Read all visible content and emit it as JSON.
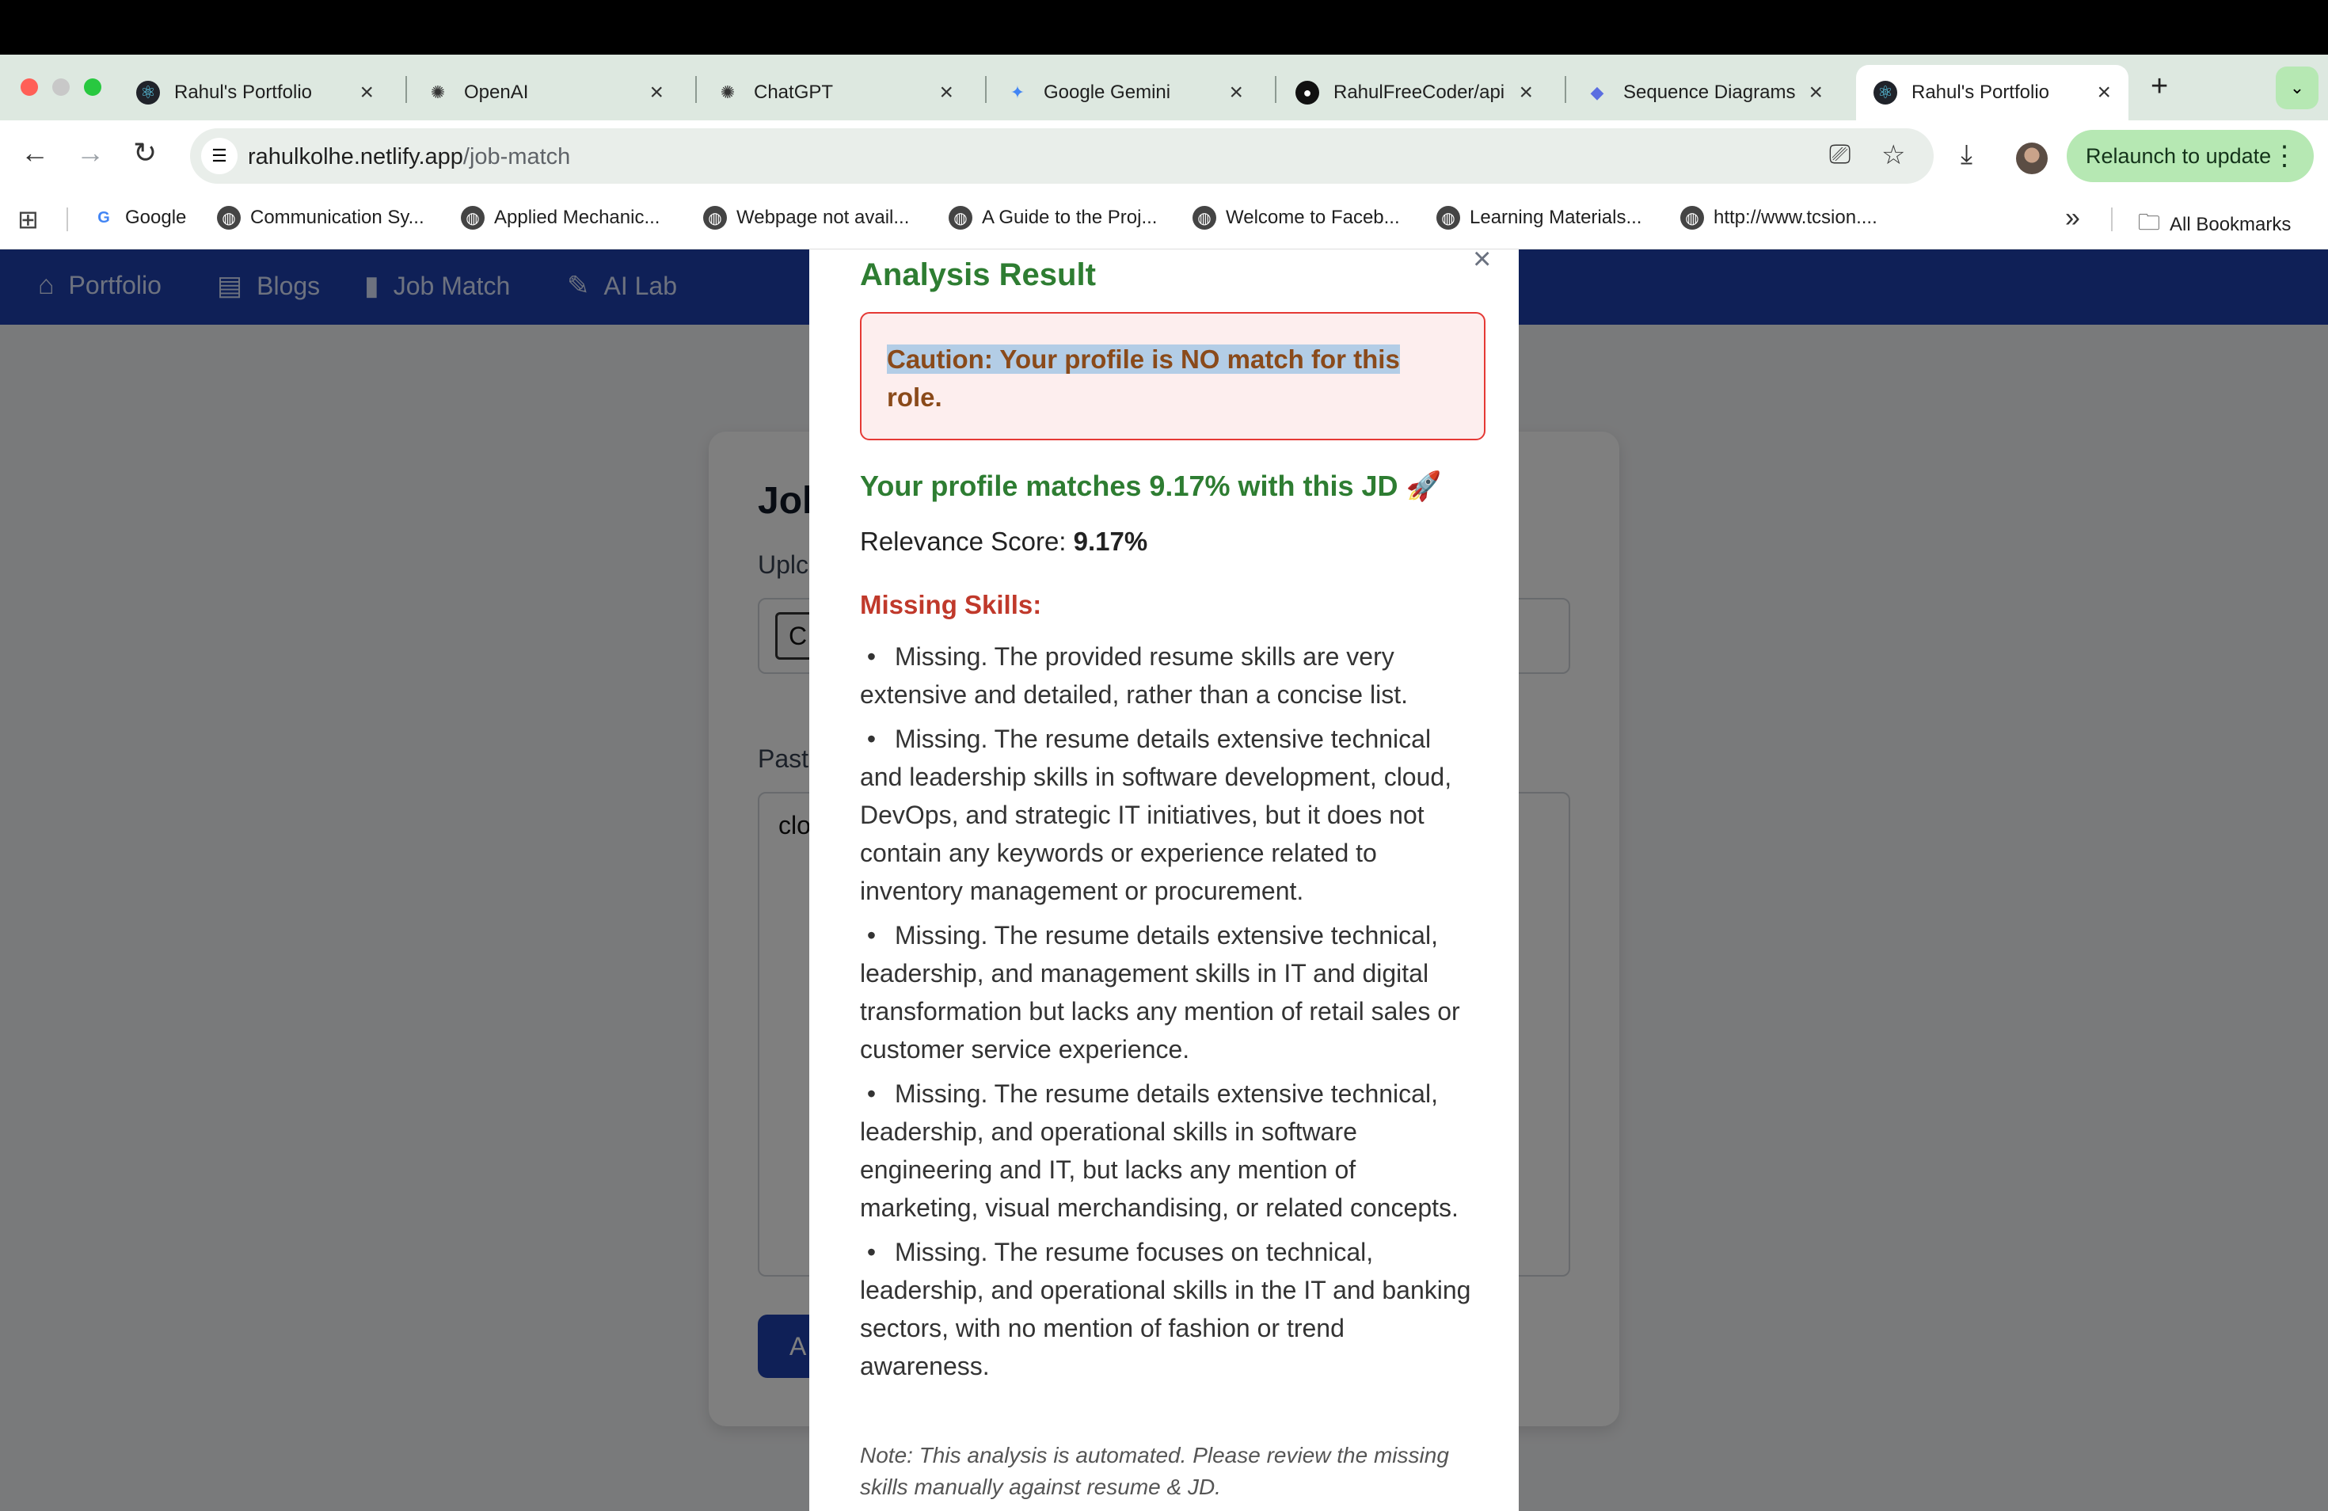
{
  "browser": {
    "tabs": [
      {
        "label": "Rahul's Portfolio",
        "icon": "react-icon",
        "active": false
      },
      {
        "label": "OpenAI",
        "icon": "openai-icon",
        "active": false
      },
      {
        "label": "ChatGPT",
        "icon": "openai-icon",
        "active": false
      },
      {
        "label": "Google Gemini",
        "icon": "gemini-icon",
        "active": false
      },
      {
        "label": "RahulFreeCoder/api",
        "icon": "github-icon",
        "active": false
      },
      {
        "label": "Sequence Diagrams",
        "icon": "sequence-icon",
        "active": false
      },
      {
        "label": "Rahul's Portfolio",
        "icon": "react-icon",
        "active": true
      }
    ],
    "url_host": "rahulkolhe.netlify.app",
    "url_path": "/job-match",
    "relaunch_label": "Relaunch to update",
    "bookmarks": [
      "Google",
      "Communication Sy...",
      "Applied Mechanic...",
      "Webpage not avail...",
      "A Guide to the Proj...",
      "Welcome to Faceb...",
      "Learning Materials...",
      "http://www.tcsion...."
    ],
    "all_bookmarks_label": "All Bookmarks"
  },
  "site_nav": {
    "items": [
      "Portfolio",
      "Blogs",
      "Job Match",
      "AI Lab"
    ]
  },
  "card": {
    "title": "Jol",
    "upload_label": "Uplc",
    "upload_button": "C",
    "paste_label": "Past",
    "textarea_value": "clo",
    "analyze_button": "A"
  },
  "modal": {
    "title": "Analysis Result",
    "close": "×",
    "caution": "Caution: Your profile is NO match for this role.",
    "match_line": "Your profile matches 9.17% with this JD 🚀",
    "score_label": "Relevance Score:",
    "score_value": "9.17%",
    "missing_title": "Missing Skills:",
    "missing_skills": [
      "Missing. The provided resume skills are very extensive and detailed, rather than a concise list.",
      "Missing. The resume details extensive technical and leadership skills in software development, cloud, DevOps, and strategic IT initiatives, but it does not contain any keywords or experience related to inventory management or procurement.",
      "Missing. The resume details extensive technical, leadership, and management skills in IT and digital transformation but lacks any mention of retail sales or customer service experience.",
      "Missing. The resume details extensive technical, leadership, and operational skills in software engineering and IT, but lacks any mention of marketing, visual merchandising, or related concepts.",
      "Missing. The resume focuses on technical, leadership, and operational skills in the IT and banking sectors, with no mention of fashion or trend awareness."
    ],
    "note": "Note: This analysis is automated. Please review the missing skills manually against resume & JD."
  }
}
